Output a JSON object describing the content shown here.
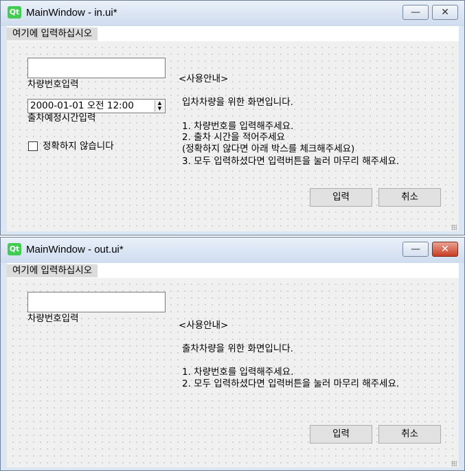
{
  "window_in": {
    "title": "MainWindow - in.ui*",
    "menu": "여기에 입력하십시오",
    "car_number_label": "차량번호입력",
    "datetime_value": "2000-01-01 오전 12:00",
    "datetime_label": "출차예정시간입력",
    "checkbox_label": "정확하지 않습니다",
    "guide_title": "<사용안내>",
    "guide_intro": "입차차량을 위한 화면입니다.",
    "guide_lines": [
      "1. 차량번호를 입력해주세요.",
      "2. 출차 시간을 적어주세요",
      "(정확하지 않다면 아래 박스를 체크해주세요)",
      "3. 모두 입력하셨다면 입력버튼을 눌러 마무리 해주세요."
    ],
    "submit_label": "입력",
    "cancel_label": "취소"
  },
  "window_out": {
    "title": "MainWindow - out.ui*",
    "menu": "여기에 입력하십시오",
    "car_number_label": "차량번호입력",
    "guide_title": "<사용안내>",
    "guide_intro": "출차차량을 위한 화면입니다.",
    "guide_lines": [
      "1. 차량번호를 입력해주세요.",
      "2. 모두 입력하셨다면 입력버튼을 눌러 마무리 해주세요."
    ],
    "submit_label": "입력",
    "cancel_label": "취소"
  },
  "titlebar_buttons": {
    "minimize": "—",
    "close": "✕"
  },
  "app_icon": "Qt",
  "colors": {
    "qt_green": "#41cd52",
    "close_active": "#c53d24"
  }
}
